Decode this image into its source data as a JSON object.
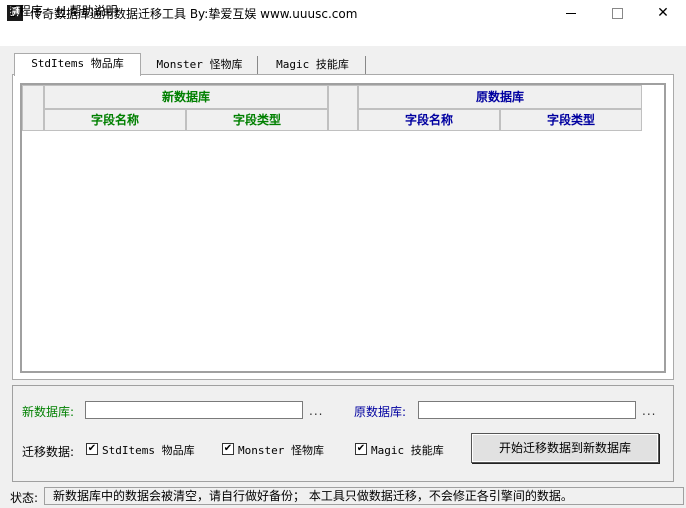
{
  "window": {
    "title": "传奇数据库通用数据迁移工具   By:挚爱互娱 www.uuusc.com",
    "icon_char": "狮",
    "close_glyph": "✕"
  },
  "menu": {
    "program": {
      "key": "F",
      "label": ".程序"
    },
    "help": {
      "key": "H",
      "label": ".帮助说明"
    }
  },
  "tabs": [
    {
      "label": "StdItems 物品库",
      "active": true
    },
    {
      "label": "Monster 怪物库",
      "active": false
    },
    {
      "label": "Magic 技能库",
      "active": false
    }
  ],
  "grid": {
    "new_db_header": "新数据库",
    "old_db_header": "原数据库",
    "columns": [
      "字段名称",
      "字段类型",
      "字段名称",
      "字段类型"
    ]
  },
  "form": {
    "new_db_label": "新数据库:",
    "old_db_label": "原数据库:",
    "new_db_value": "",
    "old_db_value": "",
    "browse_dots": "...",
    "migrate_label": "迁移数据:",
    "options": [
      {
        "label": "StdItems 物品库",
        "checked": true
      },
      {
        "label": "Monster 怪物库",
        "checked": true
      },
      {
        "label": "Magic 技能库",
        "checked": true
      }
    ],
    "start_button": "开始迁移数据到新数据库"
  },
  "status": {
    "label": "状态:",
    "text": "新数据库中的数据会被清空，请自行做好备份；  本工具只做数据迁移，不会修正各引擎间的数据。"
  },
  "colors": {
    "label_green": "#008000",
    "label_blue": "#0000a0"
  }
}
